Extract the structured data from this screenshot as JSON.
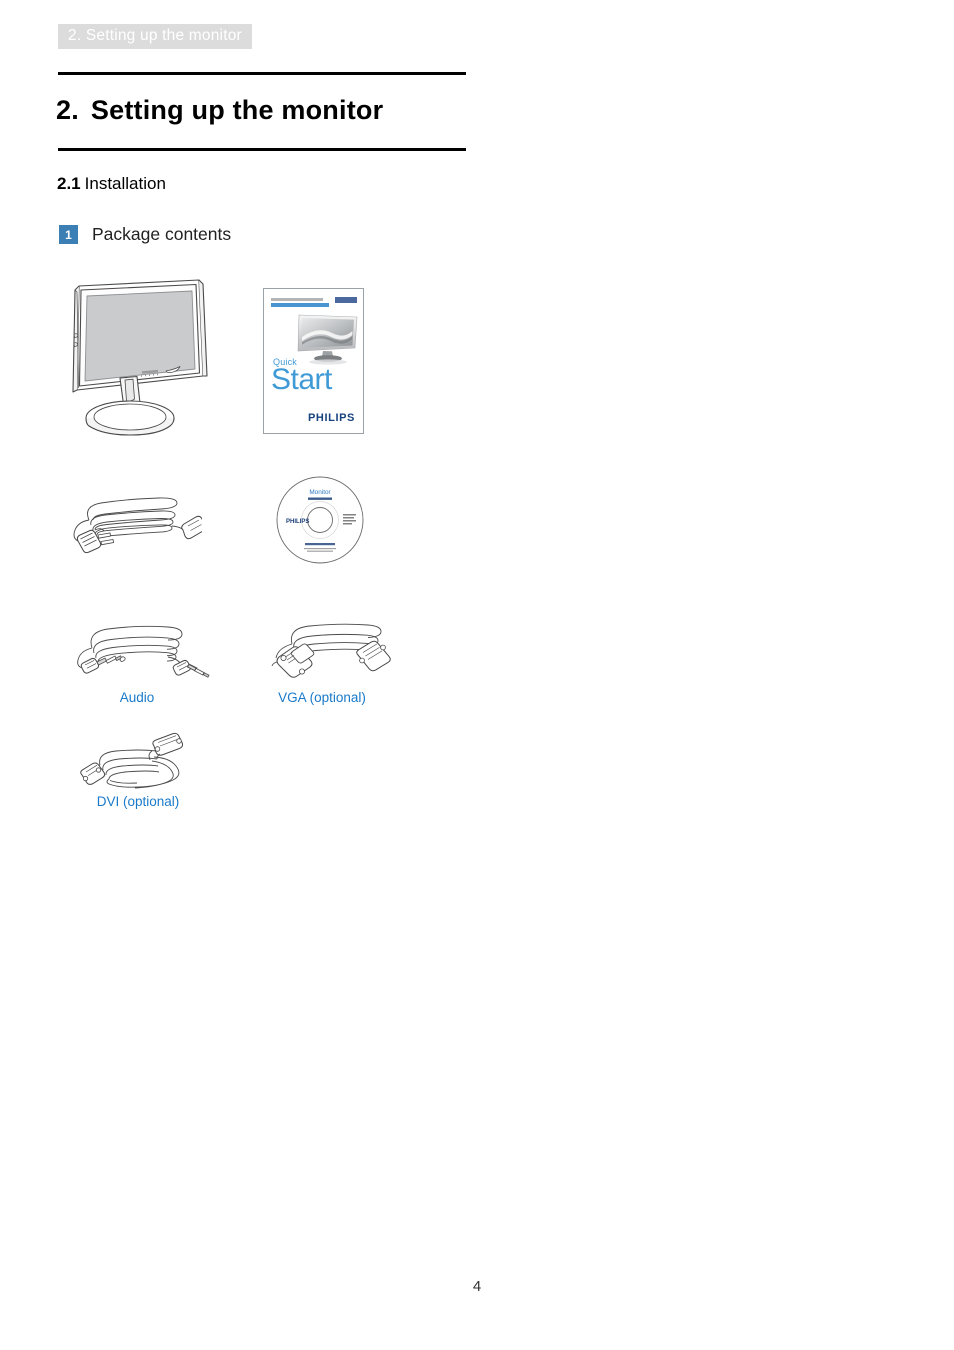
{
  "document": {
    "running_header": "2. Setting up the monitor",
    "page_number": "4"
  },
  "chapter": {
    "number": "2.",
    "title": "Setting up the monitor"
  },
  "section": {
    "number": "2.1",
    "title": "Installation"
  },
  "item": {
    "badge": "1",
    "label": "Package contents"
  },
  "figures": [
    {
      "name": "monitor",
      "caption": ""
    },
    {
      "name": "quick-start-guide",
      "caption": "",
      "cover": {
        "quick": "Quick",
        "start": "Start",
        "brand": "PHILIPS"
      }
    },
    {
      "name": "power-cable",
      "caption": ""
    },
    {
      "name": "cd-rom",
      "caption": "",
      "disc": {
        "title": "Monitor",
        "subtitle": "user manual",
        "brand": "PHILIPS"
      }
    },
    {
      "name": "audio-cable",
      "caption": "Audio"
    },
    {
      "name": "vga-cable",
      "caption": "VGA (optional)"
    },
    {
      "name": "dvi-cable",
      "caption": "DVI (optional)"
    }
  ],
  "colors": {
    "caption_blue": "#1a7ac9",
    "badge_blue": "#3b7fb5",
    "header_gray": "#dcdcdc",
    "brand_blue": "#17427f",
    "cover_blue": "#3f9ad6"
  }
}
